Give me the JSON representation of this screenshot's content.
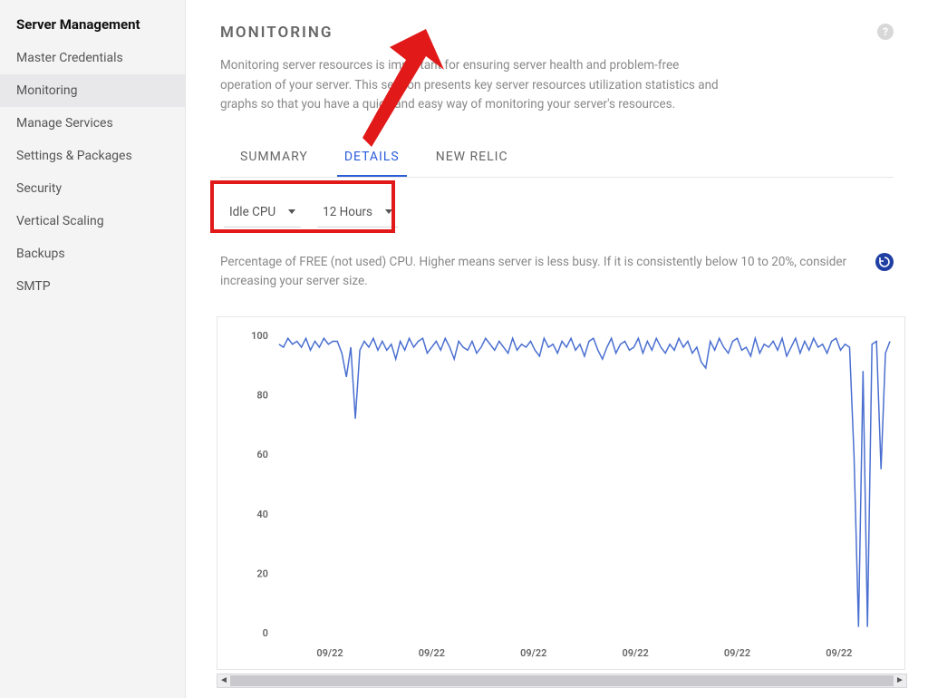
{
  "sidebar": {
    "title": "Server Management",
    "items": [
      {
        "label": "Master Credentials"
      },
      {
        "label": "Monitoring"
      },
      {
        "label": "Manage Services"
      },
      {
        "label": "Settings & Packages"
      },
      {
        "label": "Security"
      },
      {
        "label": "Vertical Scaling"
      },
      {
        "label": "Backups"
      },
      {
        "label": "SMTP"
      }
    ],
    "active_index": 1
  },
  "page": {
    "title": "MONITORING",
    "description": "Monitoring server resources is important for ensuring server health and problem-free operation of your server. This section presents key server resources utilization statistics and graphs so that you have a quick and easy way of monitoring your server's resources."
  },
  "tabs": [
    {
      "label": "SUMMARY"
    },
    {
      "label": "DETAILS"
    },
    {
      "label": "NEW RELIC"
    }
  ],
  "active_tab": 1,
  "filters": {
    "metric": "Idle CPU",
    "range": "12 Hours"
  },
  "chart_help": "Percentage of FREE (not used) CPU. Higher means server is less busy. If it is consistently below 10 to 20%, consider increasing your server size.",
  "chart_data": {
    "type": "line",
    "ylabel": "",
    "xlabel": "",
    "ylim": [
      0,
      100
    ],
    "yticks": [
      0,
      20,
      40,
      60,
      80,
      100
    ],
    "xticks": [
      "09/22",
      "09/22",
      "09/22",
      "09/22",
      "09/22",
      "09/22"
    ],
    "series": [
      {
        "name": "Idle CPU",
        "color": "#4a6fd0",
        "values": [
          97,
          96,
          99,
          97,
          98,
          96,
          99,
          95,
          98,
          96,
          99,
          97,
          98,
          98,
          94,
          86,
          96,
          72,
          95,
          98,
          96,
          99,
          95,
          98,
          95,
          97,
          92,
          98,
          95,
          99,
          96,
          98,
          99,
          94,
          96,
          98,
          95,
          99,
          96,
          92,
          98,
          96,
          95,
          98,
          94,
          96,
          99,
          97,
          95,
          98,
          96,
          94,
          99,
          95,
          97,
          96,
          98,
          95,
          93,
          99,
          96,
          97,
          94,
          98,
          96,
          99,
          95,
          97,
          93,
          98,
          99,
          95,
          92,
          96,
          99,
          94,
          97,
          98,
          95,
          96,
          99,
          94,
          98,
          95,
          99,
          96,
          94,
          97,
          95,
          99,
          96,
          98,
          94,
          96,
          91,
          89,
          98,
          95,
          99,
          96,
          94,
          98,
          99,
          95,
          96,
          93,
          99,
          94,
          97,
          96,
          98,
          95,
          99,
          93,
          96,
          99,
          94,
          98,
          95,
          99,
          96,
          97,
          94,
          98,
          99,
          95,
          97,
          96,
          60,
          2,
          88,
          2,
          97,
          98,
          55,
          94,
          98
        ]
      }
    ]
  }
}
